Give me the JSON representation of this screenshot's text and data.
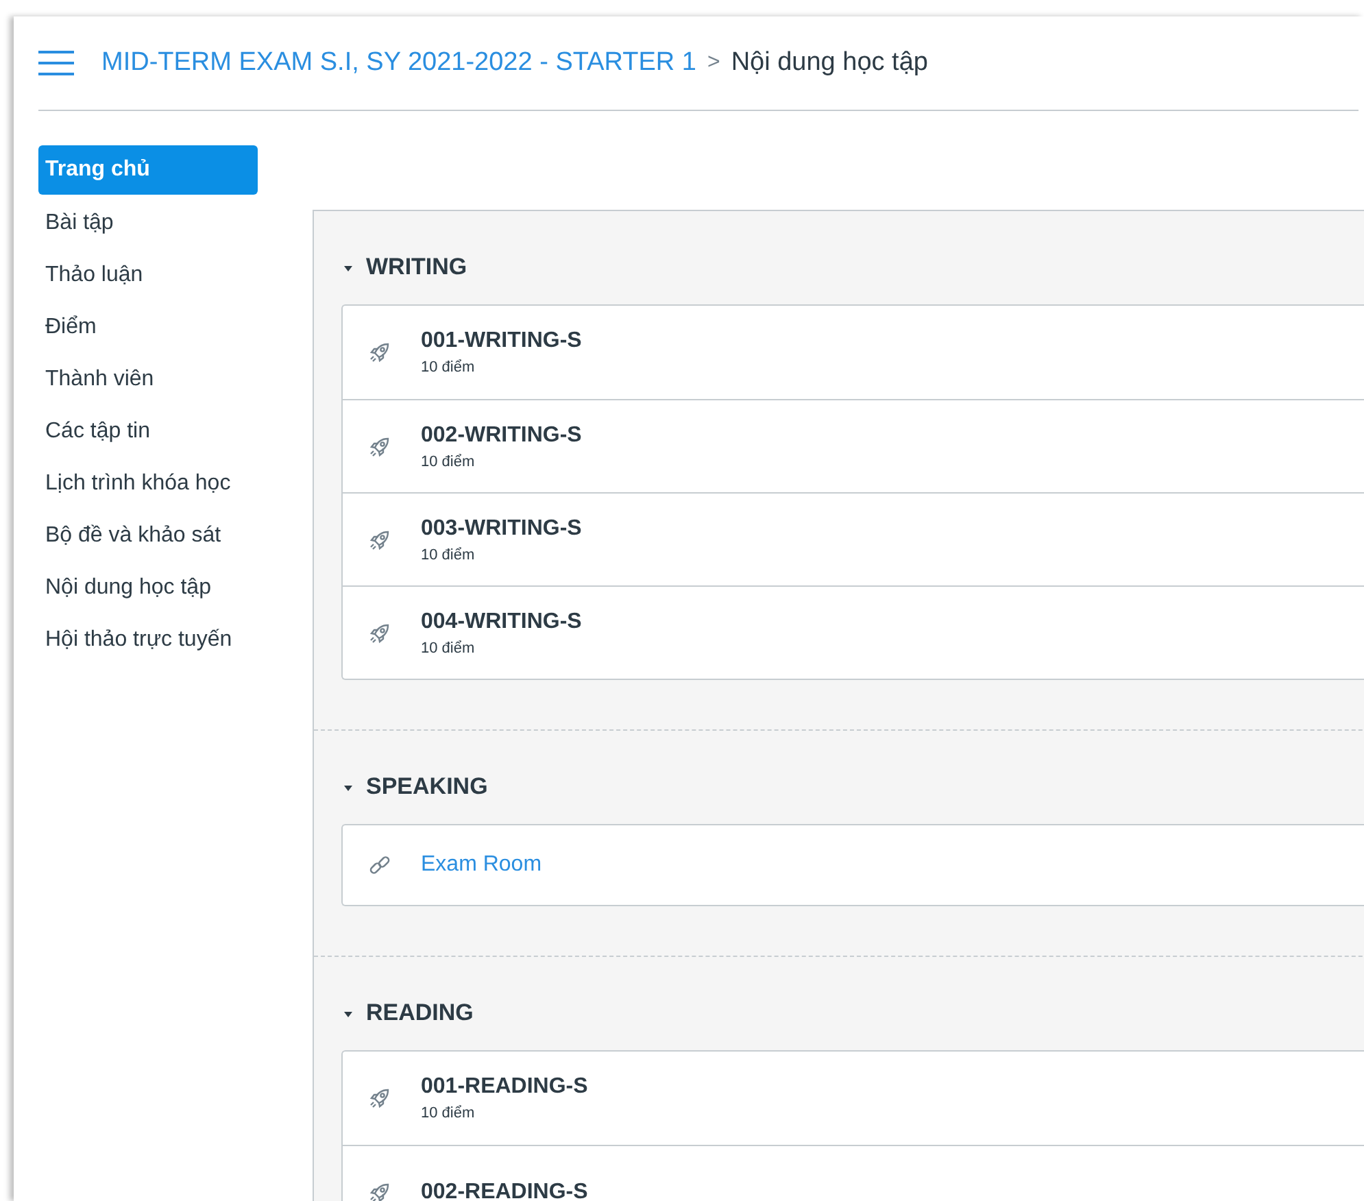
{
  "header": {
    "course": "MID-TERM EXAM S.I, SY 2021-2022 - STARTER 1",
    "separator": ">",
    "page": "Nội dung học tập"
  },
  "sidebar": {
    "items": [
      {
        "label": "Trang chủ",
        "selected": true
      },
      {
        "label": "Bài tập",
        "selected": false
      },
      {
        "label": "Thảo luận",
        "selected": false
      },
      {
        "label": "Điểm",
        "selected": false
      },
      {
        "label": "Thành viên",
        "selected": false
      },
      {
        "label": "Các tập tin",
        "selected": false
      },
      {
        "label": "Lịch trình khóa học",
        "selected": false
      },
      {
        "label": "Bộ đề và khảo sát",
        "selected": false
      },
      {
        "label": "Nội dung học tập",
        "selected": false
      },
      {
        "label": "Hội thảo trực tuyến",
        "selected": false
      }
    ]
  },
  "modules": [
    {
      "title": "WRITING",
      "expanded": true,
      "items": [
        {
          "kind": "quiz",
          "title": "001-WRITING-S",
          "points": "10 điểm"
        },
        {
          "kind": "quiz",
          "title": "002-WRITING-S",
          "points": "10 điểm"
        },
        {
          "kind": "quiz",
          "title": "003-WRITING-S",
          "points": "10 điểm"
        },
        {
          "kind": "quiz",
          "title": "004-WRITING-S",
          "points": "10 điểm"
        }
      ]
    },
    {
      "title": "SPEAKING",
      "expanded": true,
      "items": [
        {
          "kind": "link",
          "title": "Exam Room"
        }
      ]
    },
    {
      "title": "READING",
      "expanded": true,
      "items": [
        {
          "kind": "quiz",
          "title": "001-READING-S",
          "points": "10 điểm"
        },
        {
          "kind": "quiz",
          "title": "002-READING-S"
        }
      ]
    }
  ]
}
